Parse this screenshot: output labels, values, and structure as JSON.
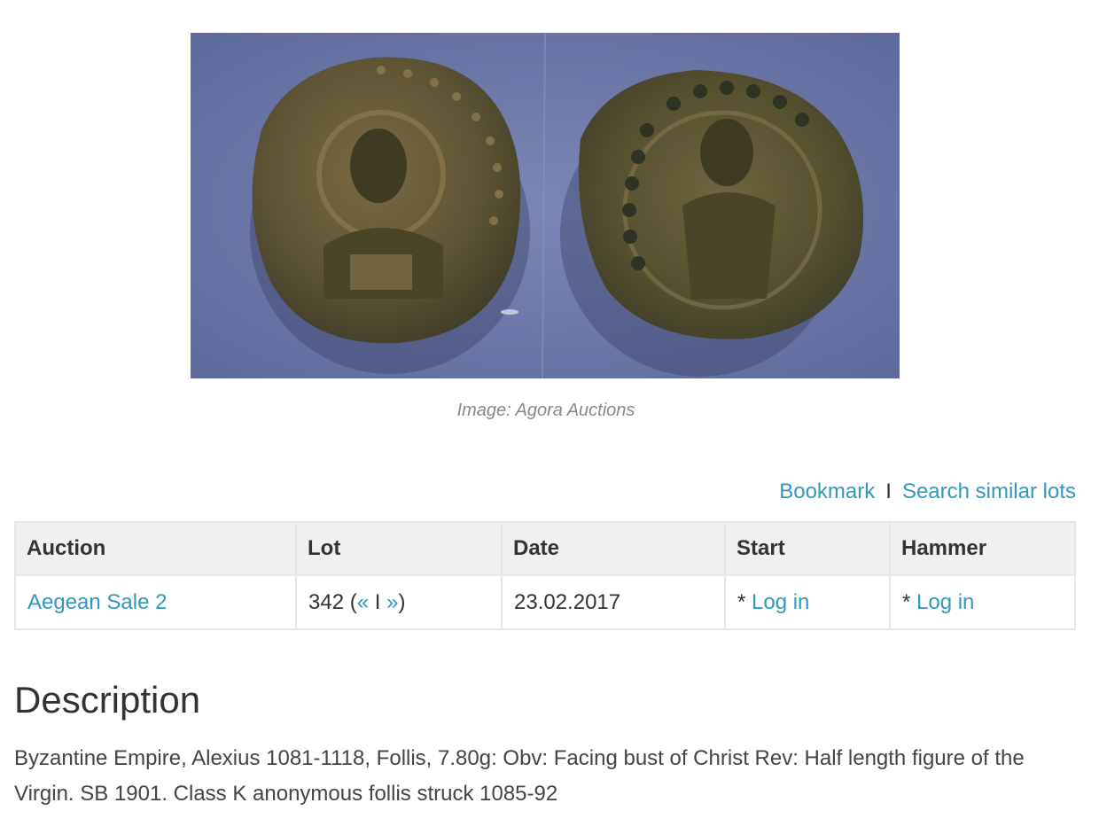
{
  "image": {
    "caption": "Image: Agora Auctions"
  },
  "actions": {
    "bookmark": "Bookmark",
    "separator": "I",
    "search_similar": "Search similar lots"
  },
  "table": {
    "headers": [
      "Auction",
      "Lot",
      "Date",
      "Start",
      "Hammer"
    ],
    "row": {
      "auction": "Aegean Sale 2",
      "lot_number": "342",
      "lot_open": " (",
      "lot_prev": "«",
      "lot_sep": " I ",
      "lot_next": "»",
      "lot_close": ")",
      "date": "23.02.2017",
      "start_prefix": "* ",
      "start_login": "Log in",
      "hammer_prefix": "* ",
      "hammer_login": "Log in"
    }
  },
  "description": {
    "heading": "Description",
    "text": "Byzantine Empire, Alexius 1081-1118, Follis, 7.80g: Obv: Facing bust of Christ Rev: Half length figure of the Virgin. SB 1901. Class K anonymous follis struck 1085-92"
  },
  "colors": {
    "link": "#3397c0",
    "header_bg": "#f0f0f0",
    "image_bg": "#6f7aab"
  }
}
